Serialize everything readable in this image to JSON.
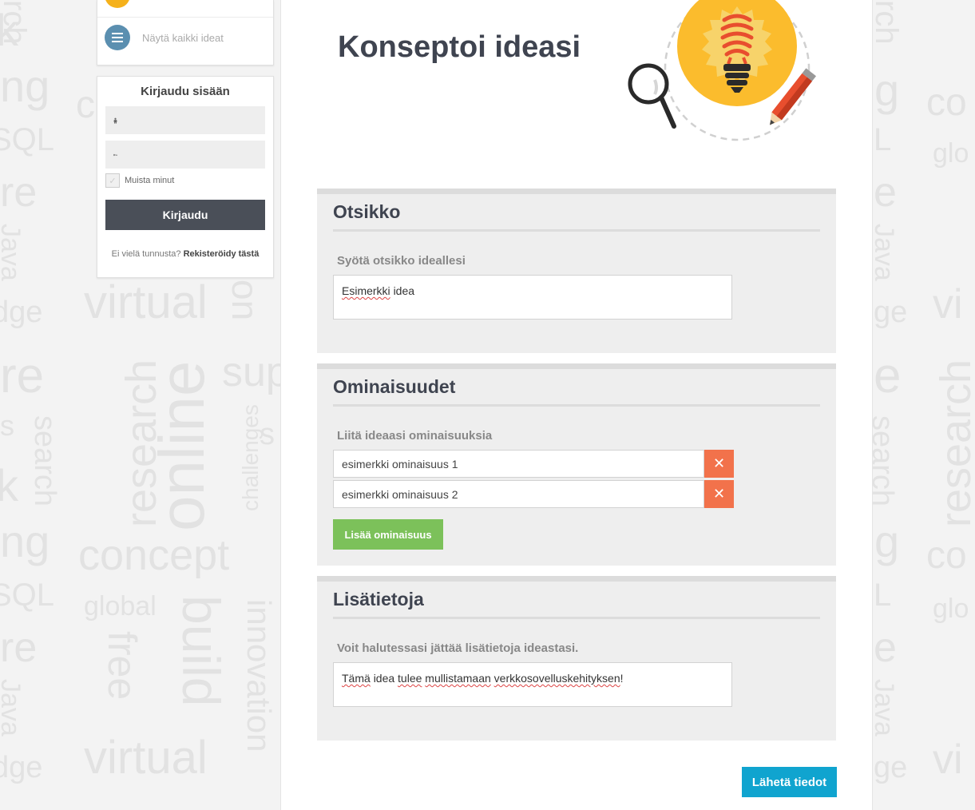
{
  "background_words": [
    "research",
    "online",
    "concept",
    "build",
    "innovation",
    "virtual",
    "free",
    "global",
    "search",
    "challenges",
    "Java",
    "SQL",
    "knowledge",
    "support",
    "share",
    "creative"
  ],
  "sidebar": {
    "nav_show_all_label": "Näytä kaikki ideat",
    "login": {
      "title": "Kirjaudu sisään",
      "remember_label": "Muista minut",
      "remember_checked": true,
      "login_button_label": "Kirjaudu",
      "register_prompt": "Ei vielä tunnusta?",
      "register_link": "Rekisteröidy tästä"
    }
  },
  "main": {
    "page_title": "Konseptoi ideasi",
    "sections": {
      "title": {
        "heading": "Otsikko",
        "label": "Syötä otsikko ideallesi",
        "value_word1": "Esimerkki",
        "value_word2": "idea"
      },
      "properties": {
        "heading": "Ominaisuudet",
        "label": "Liitä ideaasi ominaisuuksia",
        "items": [
          {
            "value": "esimerkki ominaisuus 1"
          },
          {
            "value": "esimerkki ominaisuus 2"
          }
        ],
        "remove_symbol": "✕",
        "add_button_label": "Lisää ominaisuus"
      },
      "details": {
        "heading": "Lisätietoja",
        "label": "Voit halutessasi jättää lisätietoja ideastasi.",
        "value_words": [
          "Tämä",
          "idea",
          "tulee",
          "mullistamaan",
          "verkkosovelluskehityksen",
          "!"
        ]
      }
    },
    "submit_label": "Lähetä tiedot"
  },
  "icons": {
    "nav": "list-icon",
    "user": "user-icon",
    "password": "key-icon",
    "remove": "close-icon",
    "hero": "lightbulb-illustration"
  },
  "colors": {
    "page_bg": "#f3f3f3",
    "dark": "#3f4450",
    "nav_icon": "#5b8fb0",
    "login_button": "#4a4f58",
    "remove_button": "#f2724b",
    "add_button": "#7cc15a",
    "submit_button": "#10a4cf",
    "bulb": "#fbbc2d"
  }
}
